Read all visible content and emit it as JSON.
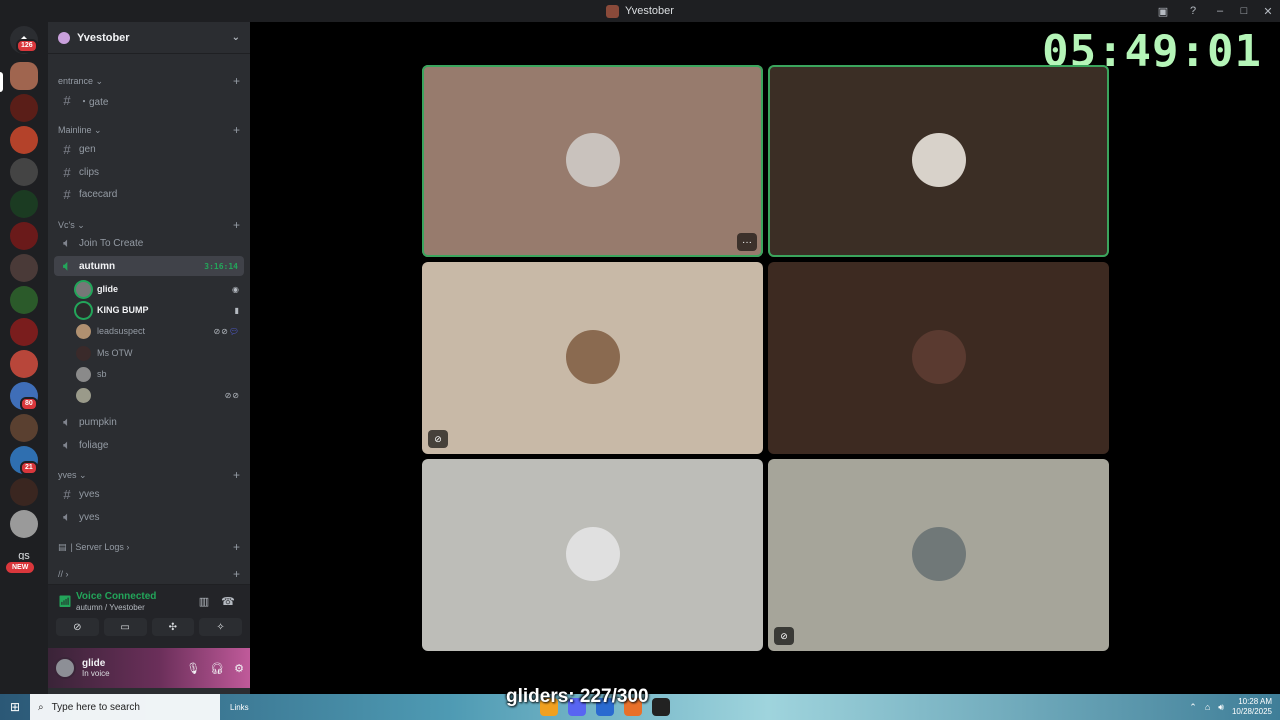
{
  "window": {
    "title": "Yvestober"
  },
  "rail": {
    "home_badge": "126",
    "badge_80": "80",
    "badge_21": "21",
    "gs_label": "gs",
    "new_label": "NEW"
  },
  "server": {
    "name": "Yvestober"
  },
  "categories": {
    "entrance": "entrance",
    "mainline": "Mainline",
    "vcs": "Vc's",
    "yves": "yves",
    "server_logs": "| Server Logs",
    "slashes": "//"
  },
  "channels": {
    "gate": "・gate",
    "gen": "gen",
    "clips": "clips",
    "facecard": "facecard",
    "join_to_create": "Join To Create",
    "autumn": "autumn",
    "autumn_timer": "3:16:14",
    "pumpkin": "pumpkin",
    "foliage": "foliage",
    "yves_text": "yves",
    "yves_voice": "yves"
  },
  "voice_users": [
    {
      "name": "glide"
    },
    {
      "name": "KING BUMP"
    },
    {
      "name": "leadsuspect"
    },
    {
      "name": "Ms OTW"
    },
    {
      "name": "sb"
    },
    {
      "name": ""
    }
  ],
  "voice_panel": {
    "title": "Voice Connected",
    "subtitle": "autumn / Yvestober"
  },
  "user": {
    "name": "glide",
    "status": "In voice"
  },
  "stage": {
    "clock": "05:49:01"
  },
  "tiles": {
    "colors": [
      "#977b6d",
      "#3b2e25",
      "#c8b9a7",
      "#3d2a21",
      "#bdbdb8",
      "#a6a59a"
    ]
  },
  "taskbar": {
    "search_placeholder": "Type here to search",
    "links_label": "Links",
    "time": "10:28 AM",
    "date": "10/28/2025"
  },
  "overlay": {
    "text": "gliders: 227/300"
  }
}
